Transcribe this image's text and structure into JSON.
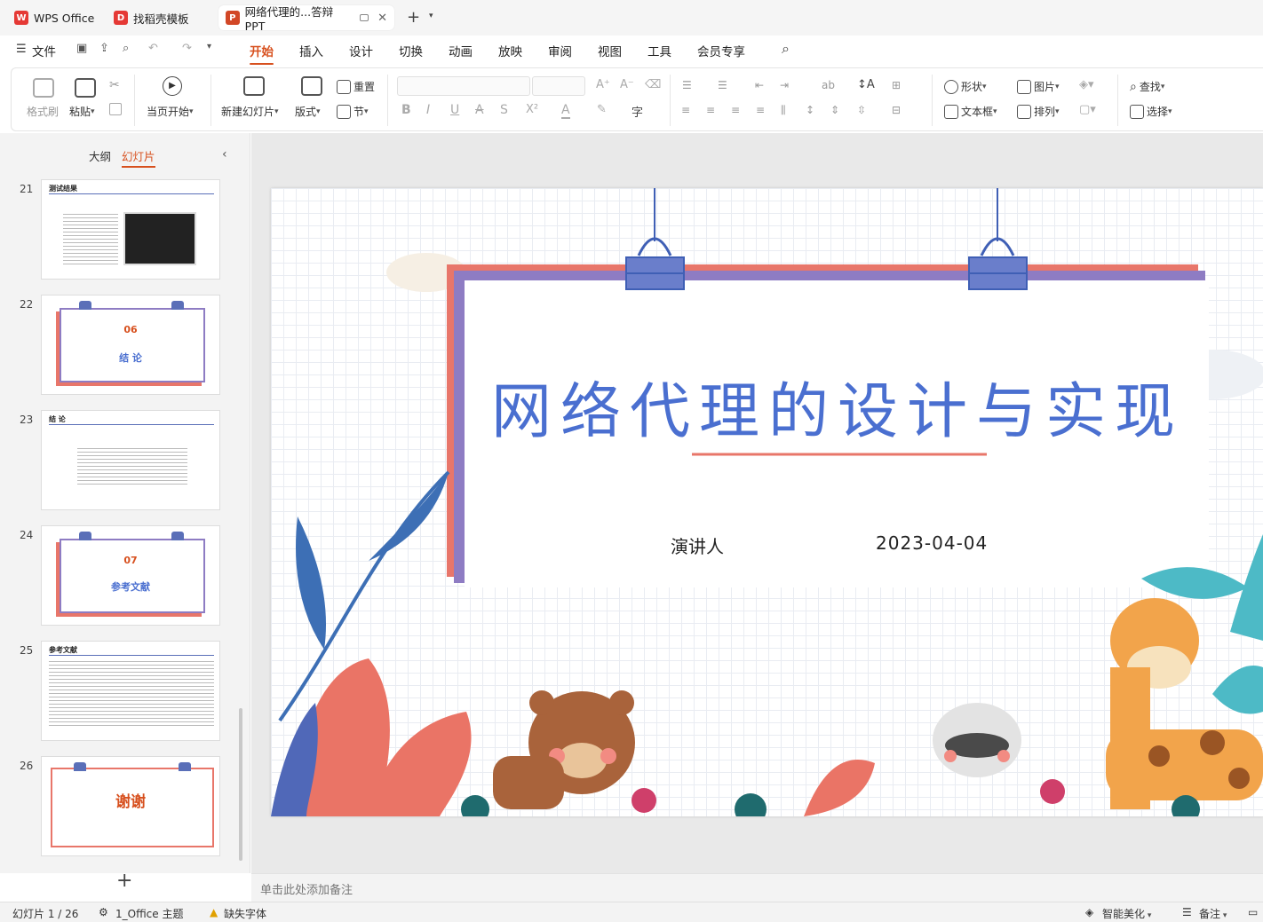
{
  "tabs": [
    {
      "label": "WPS Office",
      "icon": "wps-logo-icon"
    },
    {
      "label": "找稻壳模板",
      "icon": "docer-logo-icon"
    },
    {
      "label": "网络代理的...答辩PPT",
      "icon": "ppt-logo-icon"
    }
  ],
  "menu": [
    "文件",
    "开始",
    "插入",
    "设计",
    "切换",
    "动画",
    "放映",
    "审阅",
    "视图",
    "工具",
    "会员专享"
  ],
  "ribbon": {
    "format_painter": "格式刷",
    "paste": "粘贴",
    "start_from_current": "当页开始",
    "new_slide": "新建幻灯片",
    "layout": "版式",
    "section": "节",
    "reset": "重置",
    "shape": "形状",
    "picture": "图片",
    "find": "查找",
    "textbox": "文本框",
    "arrange": "排列",
    "select": "选择"
  },
  "panel": {
    "outline": "大纲",
    "slides": "幻灯片"
  },
  "thumbnails": [
    {
      "num": "21",
      "title": "测试结果"
    },
    {
      "num": "22",
      "index": "06",
      "label": "结 论"
    },
    {
      "num": "23",
      "title": "结 论"
    },
    {
      "num": "24",
      "index": "07",
      "label": "参考文献"
    },
    {
      "num": "25",
      "title": "参考文献"
    },
    {
      "num": "26",
      "label": "谢谢"
    }
  ],
  "slide": {
    "title": "网络代理的设计与实现",
    "presenter": "演讲人",
    "date": "2023-04-04"
  },
  "notes_placeholder": "单击此处添加备注",
  "status": {
    "slide_counter": "幻灯片 1 / 26",
    "theme": "1_Office 主题",
    "missing_font": "缺失字体",
    "smart_beautify": "智能美化",
    "notes": "备注"
  },
  "colors": {
    "accent": "#d7501e",
    "title_blue": "#4a6fd0",
    "frame_purple": "#8e7cc3",
    "frame_coral": "#e8766a",
    "clip_blue": "#5a6fb8"
  }
}
